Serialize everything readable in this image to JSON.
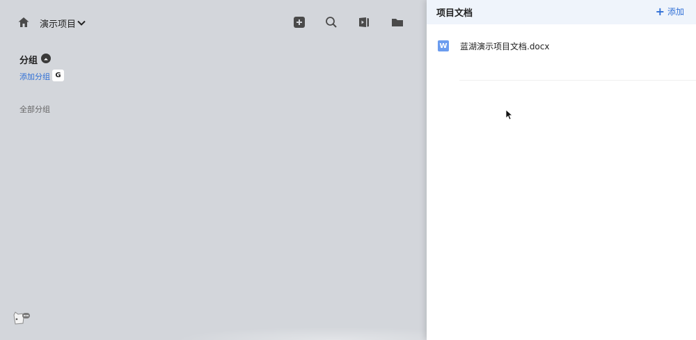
{
  "topbar": {
    "project_name": "演示项目"
  },
  "toolbar": {
    "icons": [
      "add-square-icon",
      "search-icon",
      "media-icon",
      "folder-icon"
    ]
  },
  "groups": {
    "title": "分组",
    "add_label": "添加分组",
    "shortcut_key": "G",
    "all_groups_label": "全部分组"
  },
  "panel": {
    "title": "项目文档",
    "add_label": "添加",
    "documents": [
      {
        "icon_letter": "W",
        "name": "蓝湖演示项目文档.docx"
      }
    ]
  },
  "colors": {
    "accent": "#2f6fd6",
    "overlay": "#d3d6db",
    "panel_header": "#eff4fb",
    "word_icon": "#6b9cef"
  }
}
